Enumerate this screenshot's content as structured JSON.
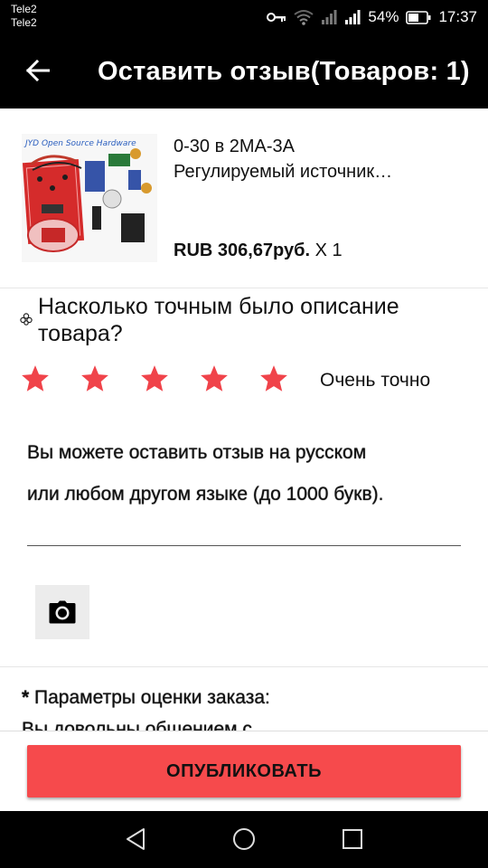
{
  "status_bar": {
    "carrier_1": "Tele2",
    "carrier_2": "Tele2",
    "battery": "54%",
    "time": "17:37",
    "icons": [
      "key-icon",
      "wifi-icon",
      "signal-icon",
      "signal-icon",
      "battery-icon"
    ]
  },
  "app_bar": {
    "title": "Оставить отзыв(Товаров: 1)",
    "back_icon": "back-arrow-icon"
  },
  "product": {
    "image_caption": "JYD Open Source Hardware",
    "name_line_1": "0-30 в 2MA-3A",
    "name_line_2": "Регулируемый источник…",
    "price_currency_bold": "RUB 306,67руб.",
    "quantity": "X 1"
  },
  "rating": {
    "question": "Насколько точным было описание товара?",
    "stars_filled": 5,
    "stars_total": 5,
    "star_color": "#f0434a",
    "label": "Очень точно"
  },
  "review": {
    "hint_line_1": "Вы можете оставить отзыв на русском",
    "hint_line_2": "или любом другом языке (до 1000 букв)."
  },
  "photo": {
    "icon": "camera-icon"
  },
  "params": {
    "required_mark": "*",
    "title": "Параметры оценки заказа:",
    "subtitle": "Вы довольны общением с"
  },
  "actions": {
    "publish_label": "ОПУБЛИКОВАТЬ",
    "publish_color": "#f64a4c"
  },
  "nav": {
    "icons": [
      "back-triangle-icon",
      "home-circle-icon",
      "recents-square-icon"
    ]
  }
}
